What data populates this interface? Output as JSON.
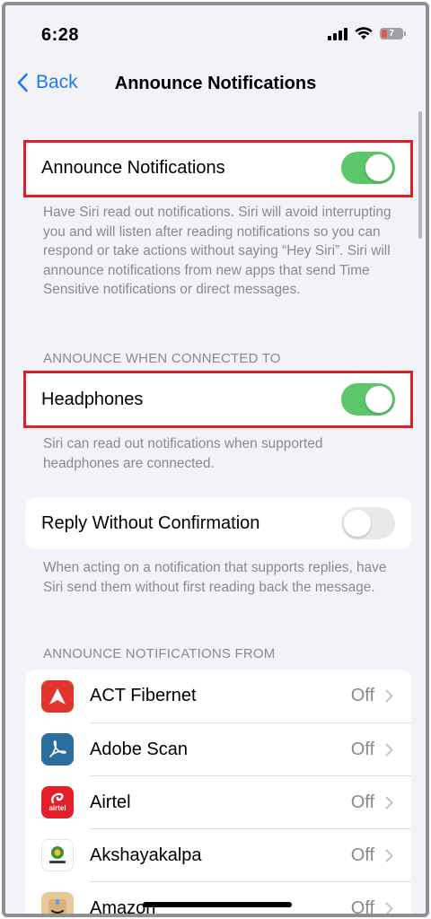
{
  "status": {
    "time": "6:28",
    "battery": "7"
  },
  "nav": {
    "back_label": "Back",
    "title": "Announce Notifications"
  },
  "announce": {
    "label": "Announce Notifications",
    "enabled": true,
    "footer": "Have Siri read out notifications. Siri will avoid interrupting you and will listen after reading notifications so you can respond or take actions without saying “Hey Siri”. Siri will announce notifications from new apps that send Time Sensitive notifications or direct messages."
  },
  "connected_section": {
    "header": "ANNOUNCE WHEN CONNECTED TO",
    "headphones_label": "Headphones",
    "headphones_enabled": true,
    "footer": "Siri can read out notifications when supported headphones are connected."
  },
  "reply": {
    "label": "Reply Without Confirmation",
    "enabled": false,
    "footer": "When acting on a notification that supports replies, have Siri send them without first reading back the message."
  },
  "apps_section": {
    "header": "ANNOUNCE NOTIFICATIONS FROM",
    "apps": [
      {
        "name": "ACT Fibernet",
        "value": "Off",
        "icon": "act-fibernet-icon"
      },
      {
        "name": "Adobe Scan",
        "value": "Off",
        "icon": "adobe-scan-icon"
      },
      {
        "name": "Airtel",
        "value": "Off",
        "icon": "airtel-icon"
      },
      {
        "name": "Akshayakalpa",
        "value": "Off",
        "icon": "akshayakalpa-icon"
      },
      {
        "name": "Amazon",
        "value": "Off",
        "icon": "amazon-icon"
      }
    ]
  },
  "app_icon_labels": {
    "airtel": "airtel"
  },
  "colors": {
    "accent": "#1a7cf5",
    "toggle_on": "#5bc76a",
    "highlight": "#d7222b"
  }
}
